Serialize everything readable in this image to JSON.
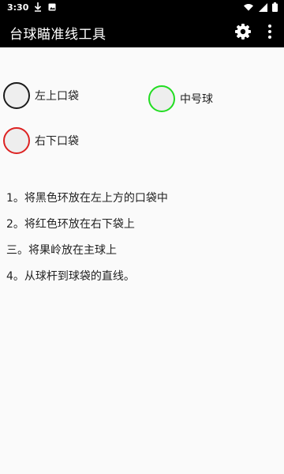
{
  "status_bar": {
    "time": "3:30"
  },
  "app_bar": {
    "title": "台球瞄准线工具"
  },
  "targets": [
    {
      "label": "左上口袋",
      "color": "#1a1a1a"
    },
    {
      "label": "中号球",
      "color": "#22dd22"
    },
    {
      "label": "右下口袋",
      "color": "#dd2222"
    }
  ],
  "steps": [
    "1。将黑色环放在左上方的口袋中",
    "2。将红色环放在右下袋上",
    "三。将果岭放在主球上",
    "4。从球杆到球袋的直线。"
  ]
}
